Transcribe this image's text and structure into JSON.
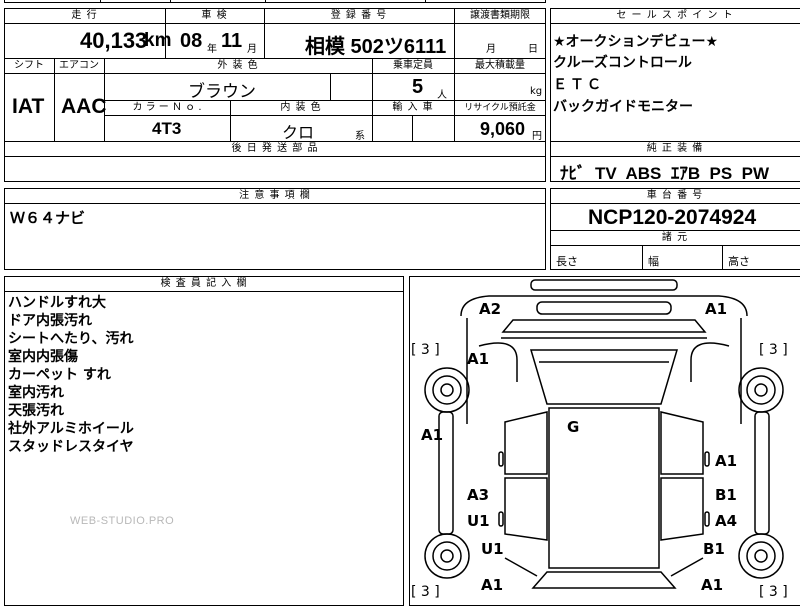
{
  "row1": {
    "mileage_header": "走 行",
    "shaken_header": "車 検",
    "reg_header": "登 録 番 号",
    "transfer_header": "譲渡書類期限",
    "mileage": "40,133",
    "mileage_unit": "km",
    "shaken_year": "08",
    "year_unit": "年",
    "shaken_month": "11",
    "month_unit": "月",
    "reg_number": "相模 502ツ6111",
    "transfer_month_unit": "月",
    "transfer_day_unit": "日"
  },
  "row2": {
    "shift_header": "シフト",
    "aircon_header": "エアコン",
    "exterior_header": "外 装 色",
    "capacity_header": "乗車定員",
    "maxload_header": "最大積載量",
    "shift": "IAT",
    "aircon": "AAC",
    "exterior_color": "ブラウン",
    "capacity": "5",
    "capacity_unit": "人",
    "maxload_unit": "kg",
    "color_no_header": "カ ラ ー Ｎ ｏ .",
    "interior_header": "内 装 色",
    "import_header": "輸 入 車",
    "recycle_header": "リサイクル預託金",
    "color_no": "4T3",
    "interior_color": "クロ",
    "interior_suffix": "系",
    "recycle_fee": "9,060",
    "recycle_unit": "円"
  },
  "later_parts_header": "後 日 発 送 部 品",
  "sales_points": {
    "header": "セ ー ル ス ポ イ ン ト",
    "items": [
      "★オークションデビュー★",
      "クルーズコントロール",
      "ＥＴＣ",
      "バックガイドモニター"
    ]
  },
  "equipment": {
    "header": "純 正 装 備",
    "value": "ﾅﾋﾞ  TV  ABS  ｴｱB  PS  PW"
  },
  "notes": {
    "header": "注 意 事 項 欄",
    "value": "Ｗ６４ナビ"
  },
  "chassis": {
    "header": "車 台 番 号",
    "value": "NCP120-2074924",
    "dims_header": "諸 元",
    "length_label": "長さ",
    "width_label": "幅",
    "height_label": "高さ"
  },
  "inspector": {
    "header": "検 査 員 記 入 欄",
    "remarks": [
      "ハンドルすれ大",
      "ドア内張汚れ",
      "シートへたり、汚れ",
      "室内内張傷",
      "カーペット すれ",
      "室内汚れ",
      "天張汚れ",
      "社外アルミホイール",
      "スタッドレスタイヤ"
    ]
  },
  "watermark": "WEB-STUDIO.PRO",
  "diagram": {
    "marks": {
      "front_left_top": "A2",
      "front_right_top": "A1",
      "tire_fl": "[ 3 ]",
      "tire_fr": "[ 3 ]",
      "fender_fl": "A1",
      "roof": "G",
      "side_left": "A1",
      "door_right_front": "A1",
      "door_left_rear_a": "A3",
      "door_right_rear_b": "B1",
      "door_left_u": "U1",
      "door_right_a4": "A4",
      "fender_rl": "U1",
      "fender_rr": "B1",
      "tire_rl": "[ 3 ]",
      "tire_rr": "[ 3 ]",
      "rear_left": "A1",
      "rear_right": "A1"
    }
  }
}
